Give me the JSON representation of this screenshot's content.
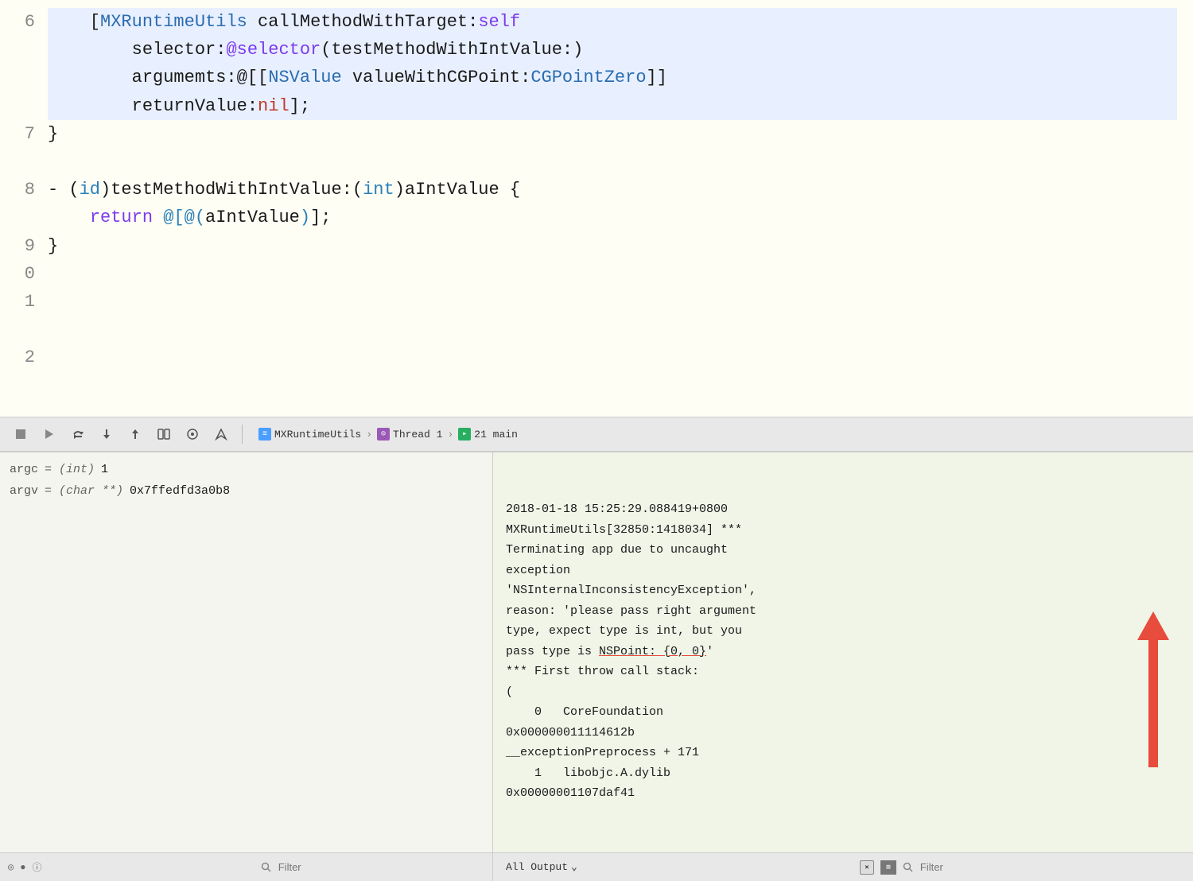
{
  "editor": {
    "background": "#fffef5",
    "lines": [
      {
        "num": "6",
        "highlighted": true,
        "tokens": [
          {
            "text": "    [",
            "class": "kw-dark"
          },
          {
            "text": "MXRuntimeUtils",
            "class": "kw-class"
          },
          {
            "text": " callMethodWithTarget:",
            "class": "kw-dark"
          },
          {
            "text": "self",
            "class": "kw-purple"
          }
        ]
      },
      {
        "num": "",
        "highlighted": true,
        "tokens": [
          {
            "text": "        selector:",
            "class": "kw-dark"
          },
          {
            "text": "@selector",
            "class": "kw-selector"
          },
          {
            "text": "(testMethodWithIntValue:)",
            "class": "kw-dark"
          }
        ]
      },
      {
        "num": "",
        "highlighted": true,
        "tokens": [
          {
            "text": "        argumemts:",
            "class": "kw-dark"
          },
          {
            "text": "@[[",
            "class": "kw-dark"
          },
          {
            "text": "NSValue",
            "class": "kw-class"
          },
          {
            "text": " valueWithCGPoint:",
            "class": "kw-dark"
          },
          {
            "text": "CGPointZero",
            "class": "kw-class"
          },
          {
            "text": "]]",
            "class": "kw-dark"
          }
        ]
      },
      {
        "num": "",
        "highlighted": true,
        "tokens": [
          {
            "text": "        returnValue:",
            "class": "kw-dark"
          },
          {
            "text": "nil",
            "class": "kw-red"
          },
          {
            "text": "];",
            "class": "kw-dark"
          }
        ]
      },
      {
        "num": "7",
        "highlighted": false,
        "tokens": [
          {
            "text": "}",
            "class": "kw-dark"
          }
        ]
      },
      {
        "num": "8",
        "highlighted": false,
        "tokens": []
      },
      {
        "num": "9",
        "highlighted": false,
        "tokens": [
          {
            "text": "- ",
            "class": "kw-dark"
          },
          {
            "text": "(",
            "class": "kw-dark"
          },
          {
            "text": "id",
            "class": "kw-int"
          },
          {
            "text": ")",
            "class": "kw-dark"
          },
          {
            "text": "testMethodWithIntValue:",
            "class": "kw-dark"
          },
          {
            "text": "(",
            "class": "kw-dark"
          },
          {
            "text": "int",
            "class": "kw-int"
          },
          {
            "text": ")",
            "class": "kw-dark"
          },
          {
            "text": "aIntValue {",
            "class": "kw-dark"
          }
        ]
      },
      {
        "num": "0",
        "highlighted": false,
        "tokens": [
          {
            "text": "    return ",
            "class": "kw-dark"
          },
          {
            "text": "@[",
            "class": "kw-at"
          },
          {
            "text": "@(aIntValue)",
            "class": "kw-dark"
          },
          {
            "text": "];",
            "class": "kw-dark"
          }
        ]
      },
      {
        "num": "1",
        "highlighted": false,
        "tokens": [
          {
            "text": "}",
            "class": "kw-dark"
          }
        ]
      },
      {
        "num": "2",
        "highlighted": false,
        "tokens": []
      }
    ]
  },
  "toolbar": {
    "buttons": [
      "▶",
      "▷",
      "△",
      "↓",
      "↑",
      "⊡",
      "⊕",
      "⊳"
    ],
    "breadcrumb": [
      {
        "icon": "file",
        "label": "MXRuntimeUtils"
      },
      {
        "icon": "thread",
        "label": "Thread 1"
      },
      {
        "icon": "frame",
        "label": "21 main"
      }
    ]
  },
  "variables": {
    "entries": [
      {
        "name": "argc",
        "type": "(int)",
        "value": "1"
      },
      {
        "name": "argv",
        "type": "(char **)",
        "value": "0x7ffedfd3a0b8"
      }
    ],
    "filter_placeholder": "Filter"
  },
  "console": {
    "output": "2018-01-18 15:25:29.088419+0800\nMXRuntimeUtils[32850:1418034] ***\nTerminating app due to uncaught\nexception\n'NSInternalInconsistencyException',\nreason: 'please pass right argument\ntype, expect type is int, but you\npass type is NSPoint: {0, 0}'\n*** First throw call stack:\n(\n    0   CoreFoundation\n0x000000011114612b\n__exceptionPreprocess + 171\n    1   libobjc.A.dylib\n0x00000001107daf41",
    "underline_text": "NSPoint: {0, 0}",
    "output_selector": "All Output",
    "filter_placeholder": "Filter"
  }
}
